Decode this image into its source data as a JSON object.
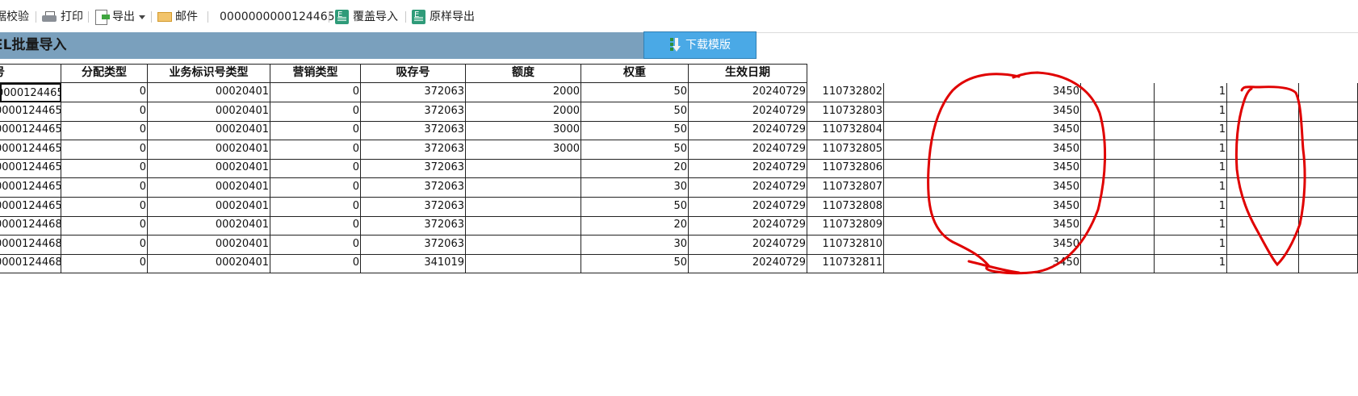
{
  "toolbar": {
    "items": [
      {
        "label": "据校验",
        "icon": "check-icon"
      },
      {
        "label": "打印",
        "icon": "printer-icon"
      },
      {
        "label": "导出",
        "icon": "export-icon"
      },
      {
        "label": "邮件",
        "icon": "mail-icon"
      },
      {
        "label": "0000000000124465",
        "icon": ""
      },
      {
        "label": "覆盖导入",
        "icon": "excel-import-icon"
      },
      {
        "label": "原样导出",
        "icon": "excel-export-icon"
      }
    ]
  },
  "panel": {
    "title": "EL批量导入",
    "download_label": "下载模版"
  },
  "table": {
    "columns": [
      "号",
      "分配类型",
      "业务标识号类型",
      "营销类型",
      "吸存号",
      "额度",
      "权重",
      "生效日期"
    ],
    "rows": [
      [
        "0000124465",
        "0",
        "00020401",
        "0",
        "372063",
        "2000",
        "50",
        "20240729",
        "110732802",
        "3450",
        "",
        "1",
        "",
        ""
      ],
      [
        "0000124465",
        "0",
        "00020401",
        "0",
        "372063",
        "2000",
        "50",
        "20240729",
        "110732803",
        "3450",
        "",
        "1",
        "",
        ""
      ],
      [
        "0000124465",
        "0",
        "00020401",
        "0",
        "372063",
        "3000",
        "50",
        "20240729",
        "110732804",
        "3450",
        "",
        "1",
        "",
        ""
      ],
      [
        "0000124465",
        "0",
        "00020401",
        "0",
        "372063",
        "3000",
        "50",
        "20240729",
        "110732805",
        "3450",
        "",
        "1",
        "",
        ""
      ],
      [
        "0000124465",
        "0",
        "00020401",
        "0",
        "372063",
        "",
        "20",
        "20240729",
        "110732806",
        "3450",
        "",
        "1",
        "",
        ""
      ],
      [
        "0000124465",
        "0",
        "00020401",
        "0",
        "372063",
        "",
        "30",
        "20240729",
        "110732807",
        "3450",
        "",
        "1",
        "",
        ""
      ],
      [
        "0000124465",
        "0",
        "00020401",
        "0",
        "372063",
        "",
        "50",
        "20240729",
        "110732808",
        "3450",
        "",
        "1",
        "",
        ""
      ],
      [
        "0000124468",
        "0",
        "00020401",
        "0",
        "372063",
        "",
        "20",
        "20240729",
        "110732809",
        "3450",
        "",
        "1",
        "",
        ""
      ],
      [
        "0000124468",
        "0",
        "00020401",
        "0",
        "372063",
        "",
        "30",
        "20240729",
        "110732810",
        "3450",
        "",
        "1",
        "",
        ""
      ],
      [
        "0000124468",
        "0",
        "00020401",
        "0",
        "341019",
        "",
        "50",
        "20240729",
        "110732811",
        "3450",
        "",
        "1",
        "",
        ""
      ]
    ]
  },
  "colors": {
    "header_bar": "#7aa0bd",
    "download_button": "#4aa9e6",
    "annotation_red": "#e00000"
  }
}
